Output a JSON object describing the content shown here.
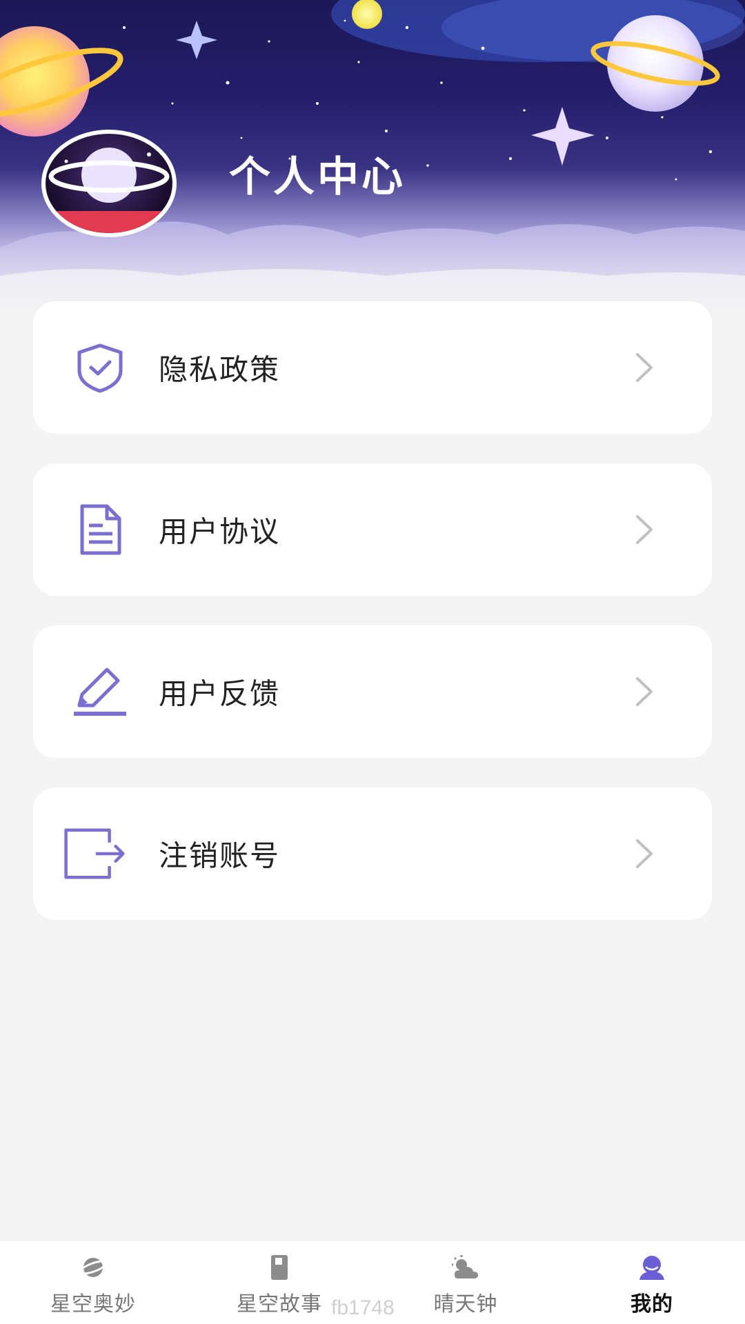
{
  "header": {
    "title": "个人中心"
  },
  "menu": {
    "items": [
      {
        "label": "隐私政策",
        "icon": "shield-check-icon"
      },
      {
        "label": "用户协议",
        "icon": "document-icon"
      },
      {
        "label": "用户反馈",
        "icon": "pencil-edit-icon"
      },
      {
        "label": "注销账号",
        "icon": "logout-icon"
      }
    ]
  },
  "tabbar": {
    "tabs": [
      {
        "label": "星空奥妙",
        "icon": "planet-icon",
        "active": false
      },
      {
        "label": "星空故事",
        "icon": "book-icon",
        "active": false
      },
      {
        "label": "晴天钟",
        "icon": "weather-icon",
        "active": false
      },
      {
        "label": "我的",
        "icon": "profile-icon",
        "active": true
      }
    ]
  },
  "watermark": "fb1748",
  "colors": {
    "accent": "#7a6fd0",
    "chevron": "#c0c0c0",
    "page_bg": "#f4f4f4",
    "card_bg": "#ffffff"
  }
}
